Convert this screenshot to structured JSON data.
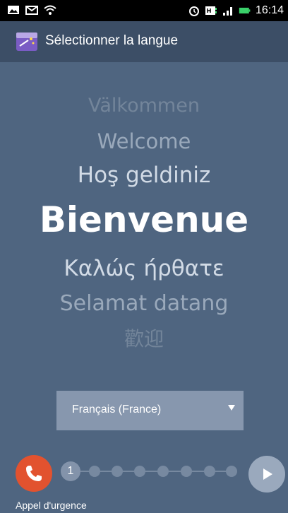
{
  "status_bar": {
    "time": "16:14",
    "icons": [
      "image-icon",
      "mail-icon",
      "wifi-icon",
      "alarm-icon",
      "hplus-icon",
      "signal-icon",
      "battery-icon"
    ]
  },
  "app_bar": {
    "title": "Sélectionner la langue",
    "icon": "setup-wizard-icon"
  },
  "welcome_words": [
    "Välkommen",
    "Welcome",
    "Hoş geldiniz",
    "Bienvenue",
    "Καλώς ήρθατε",
    "Selamat datang",
    "歡迎"
  ],
  "language_select": {
    "selected": "Français (France)"
  },
  "bottom": {
    "emergency_label": "Appel d'urgence",
    "current_step": "1",
    "total_steps": 8
  },
  "colors": {
    "background": "#4f6580",
    "app_bar": "#3c4e66",
    "emergency": "#e2522f"
  }
}
